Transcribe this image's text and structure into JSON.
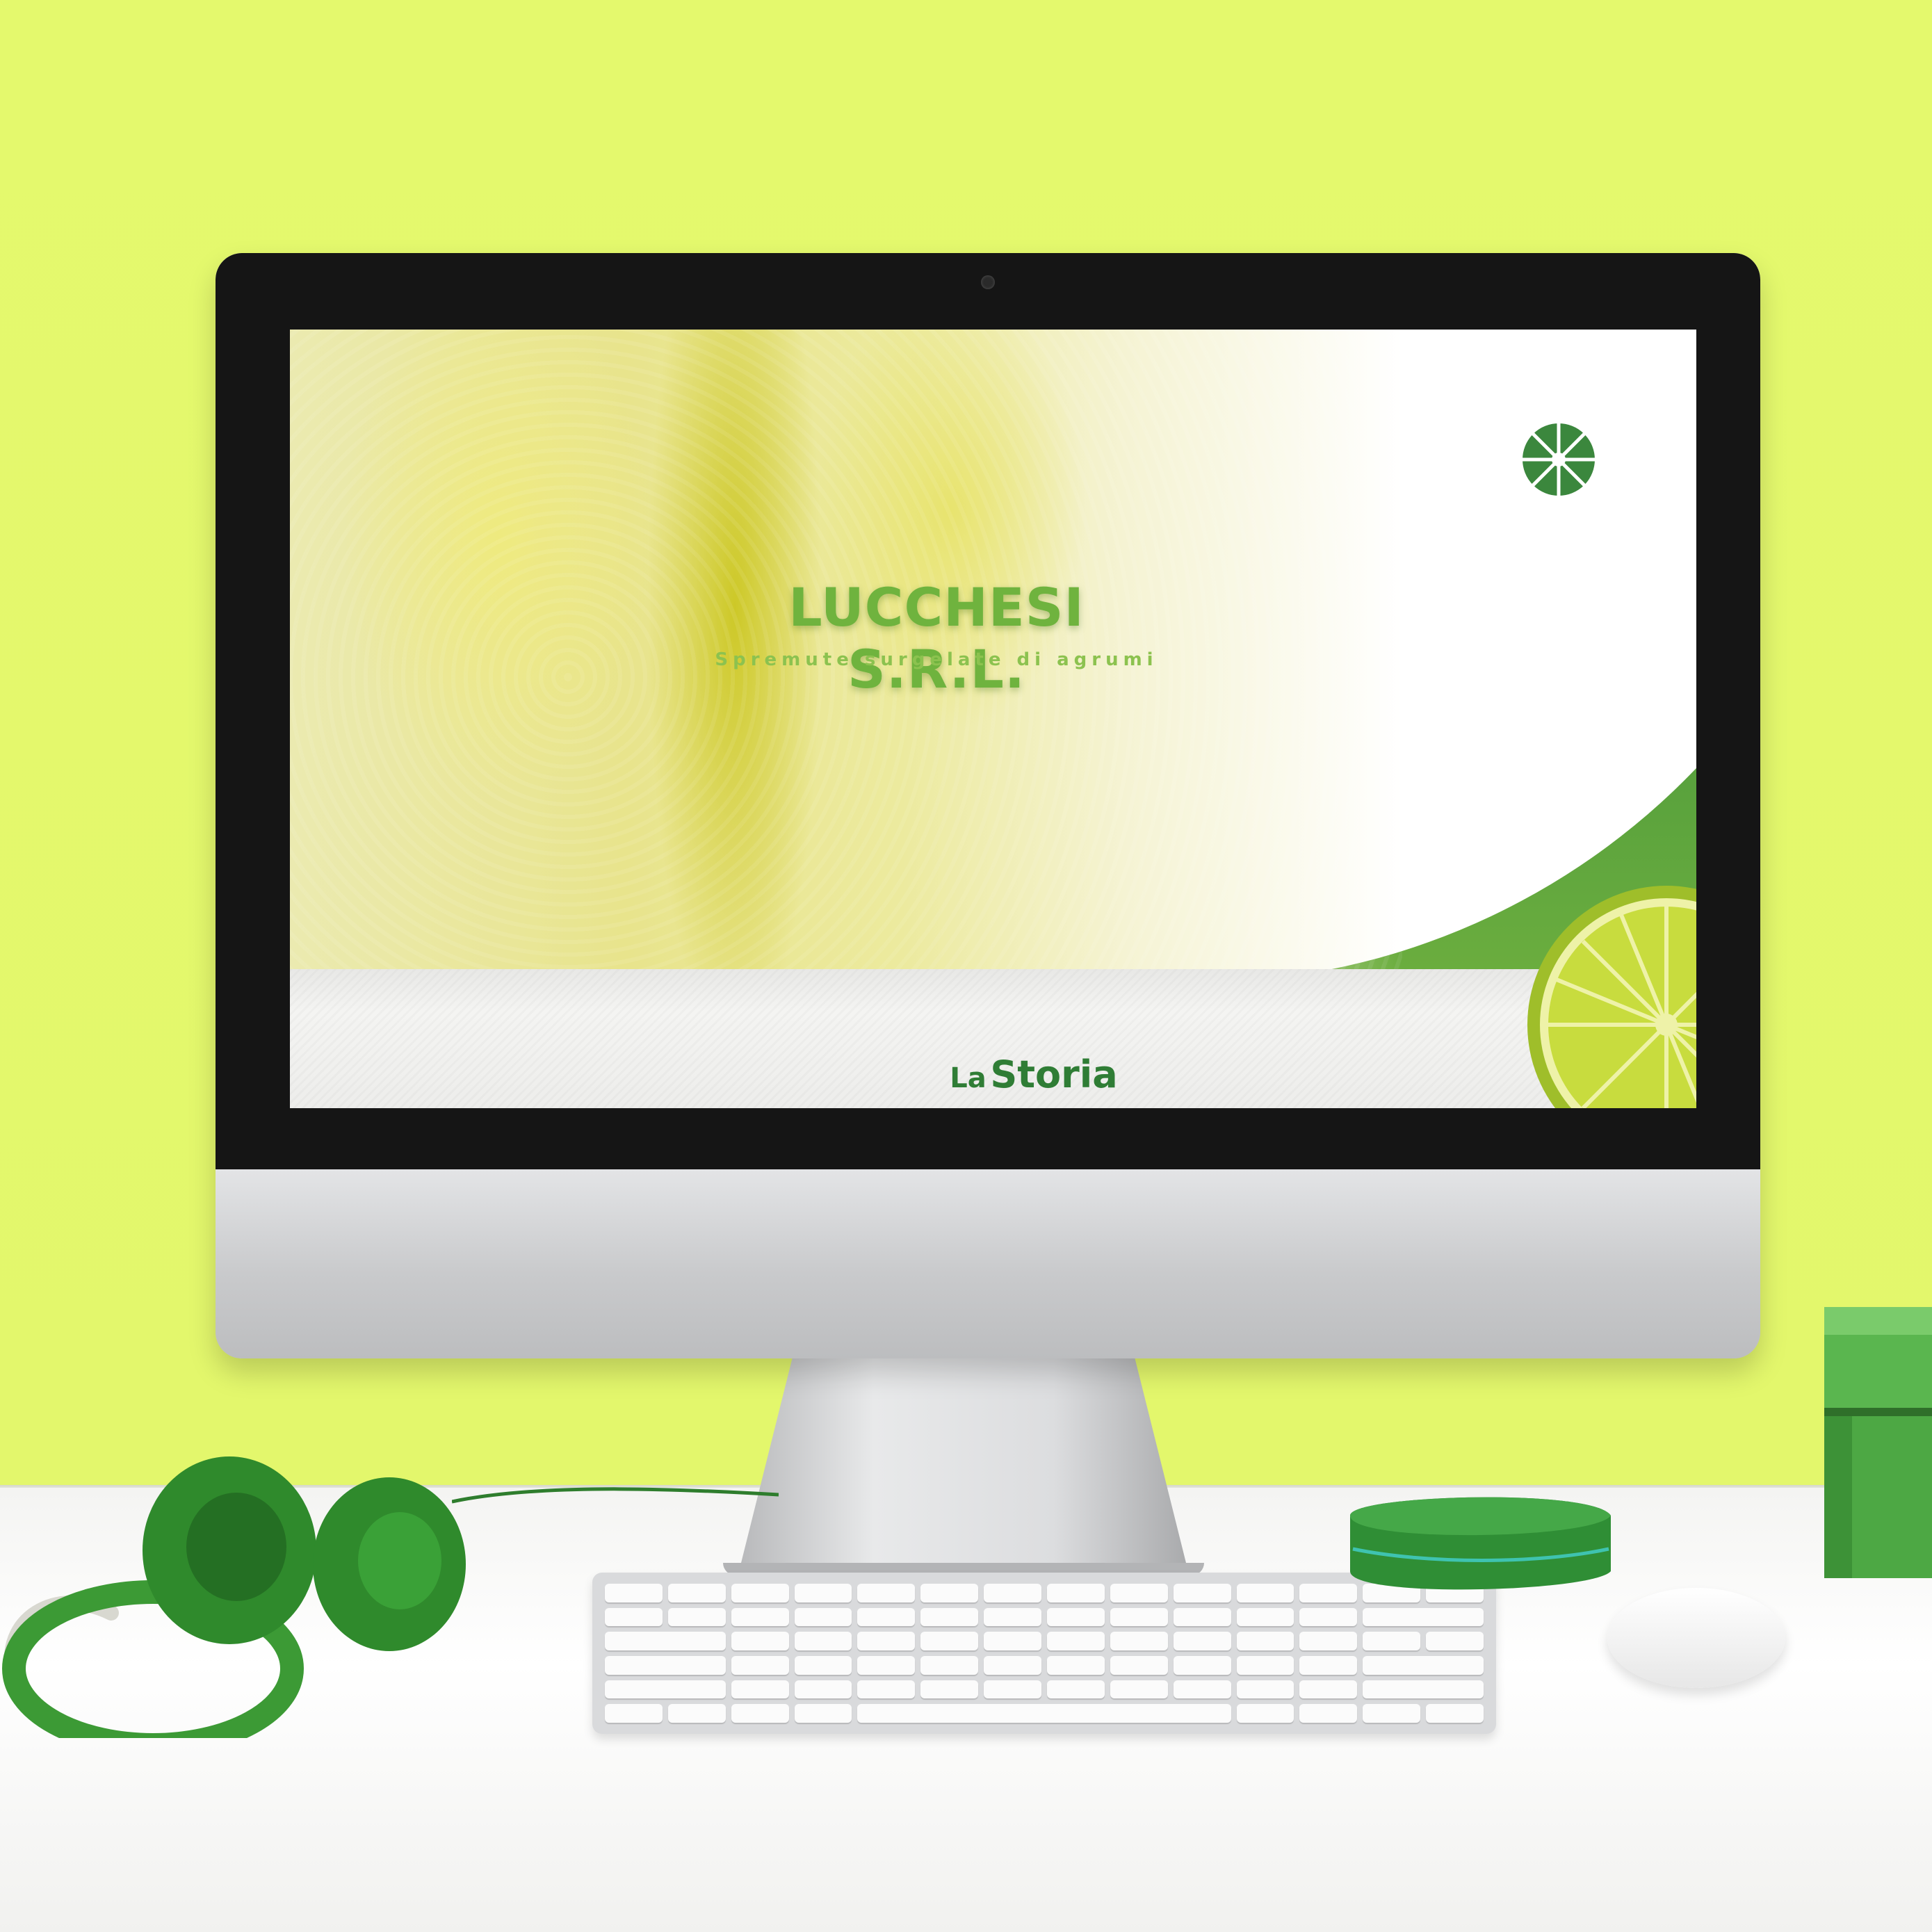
{
  "website": {
    "brand_title": "LUCCHESI S.R.L.",
    "brand_subtitle": "Spremute surgelate di agrumi",
    "section_prefix": "La",
    "section_title": "Storia",
    "logo_icon": "citrus-slice-logo-icon",
    "colors": {
      "primary_green": "#3b873d",
      "accent_green": "#6fb33e",
      "title_green": "#2f7d35",
      "wall": "#e4f96d"
    }
  }
}
